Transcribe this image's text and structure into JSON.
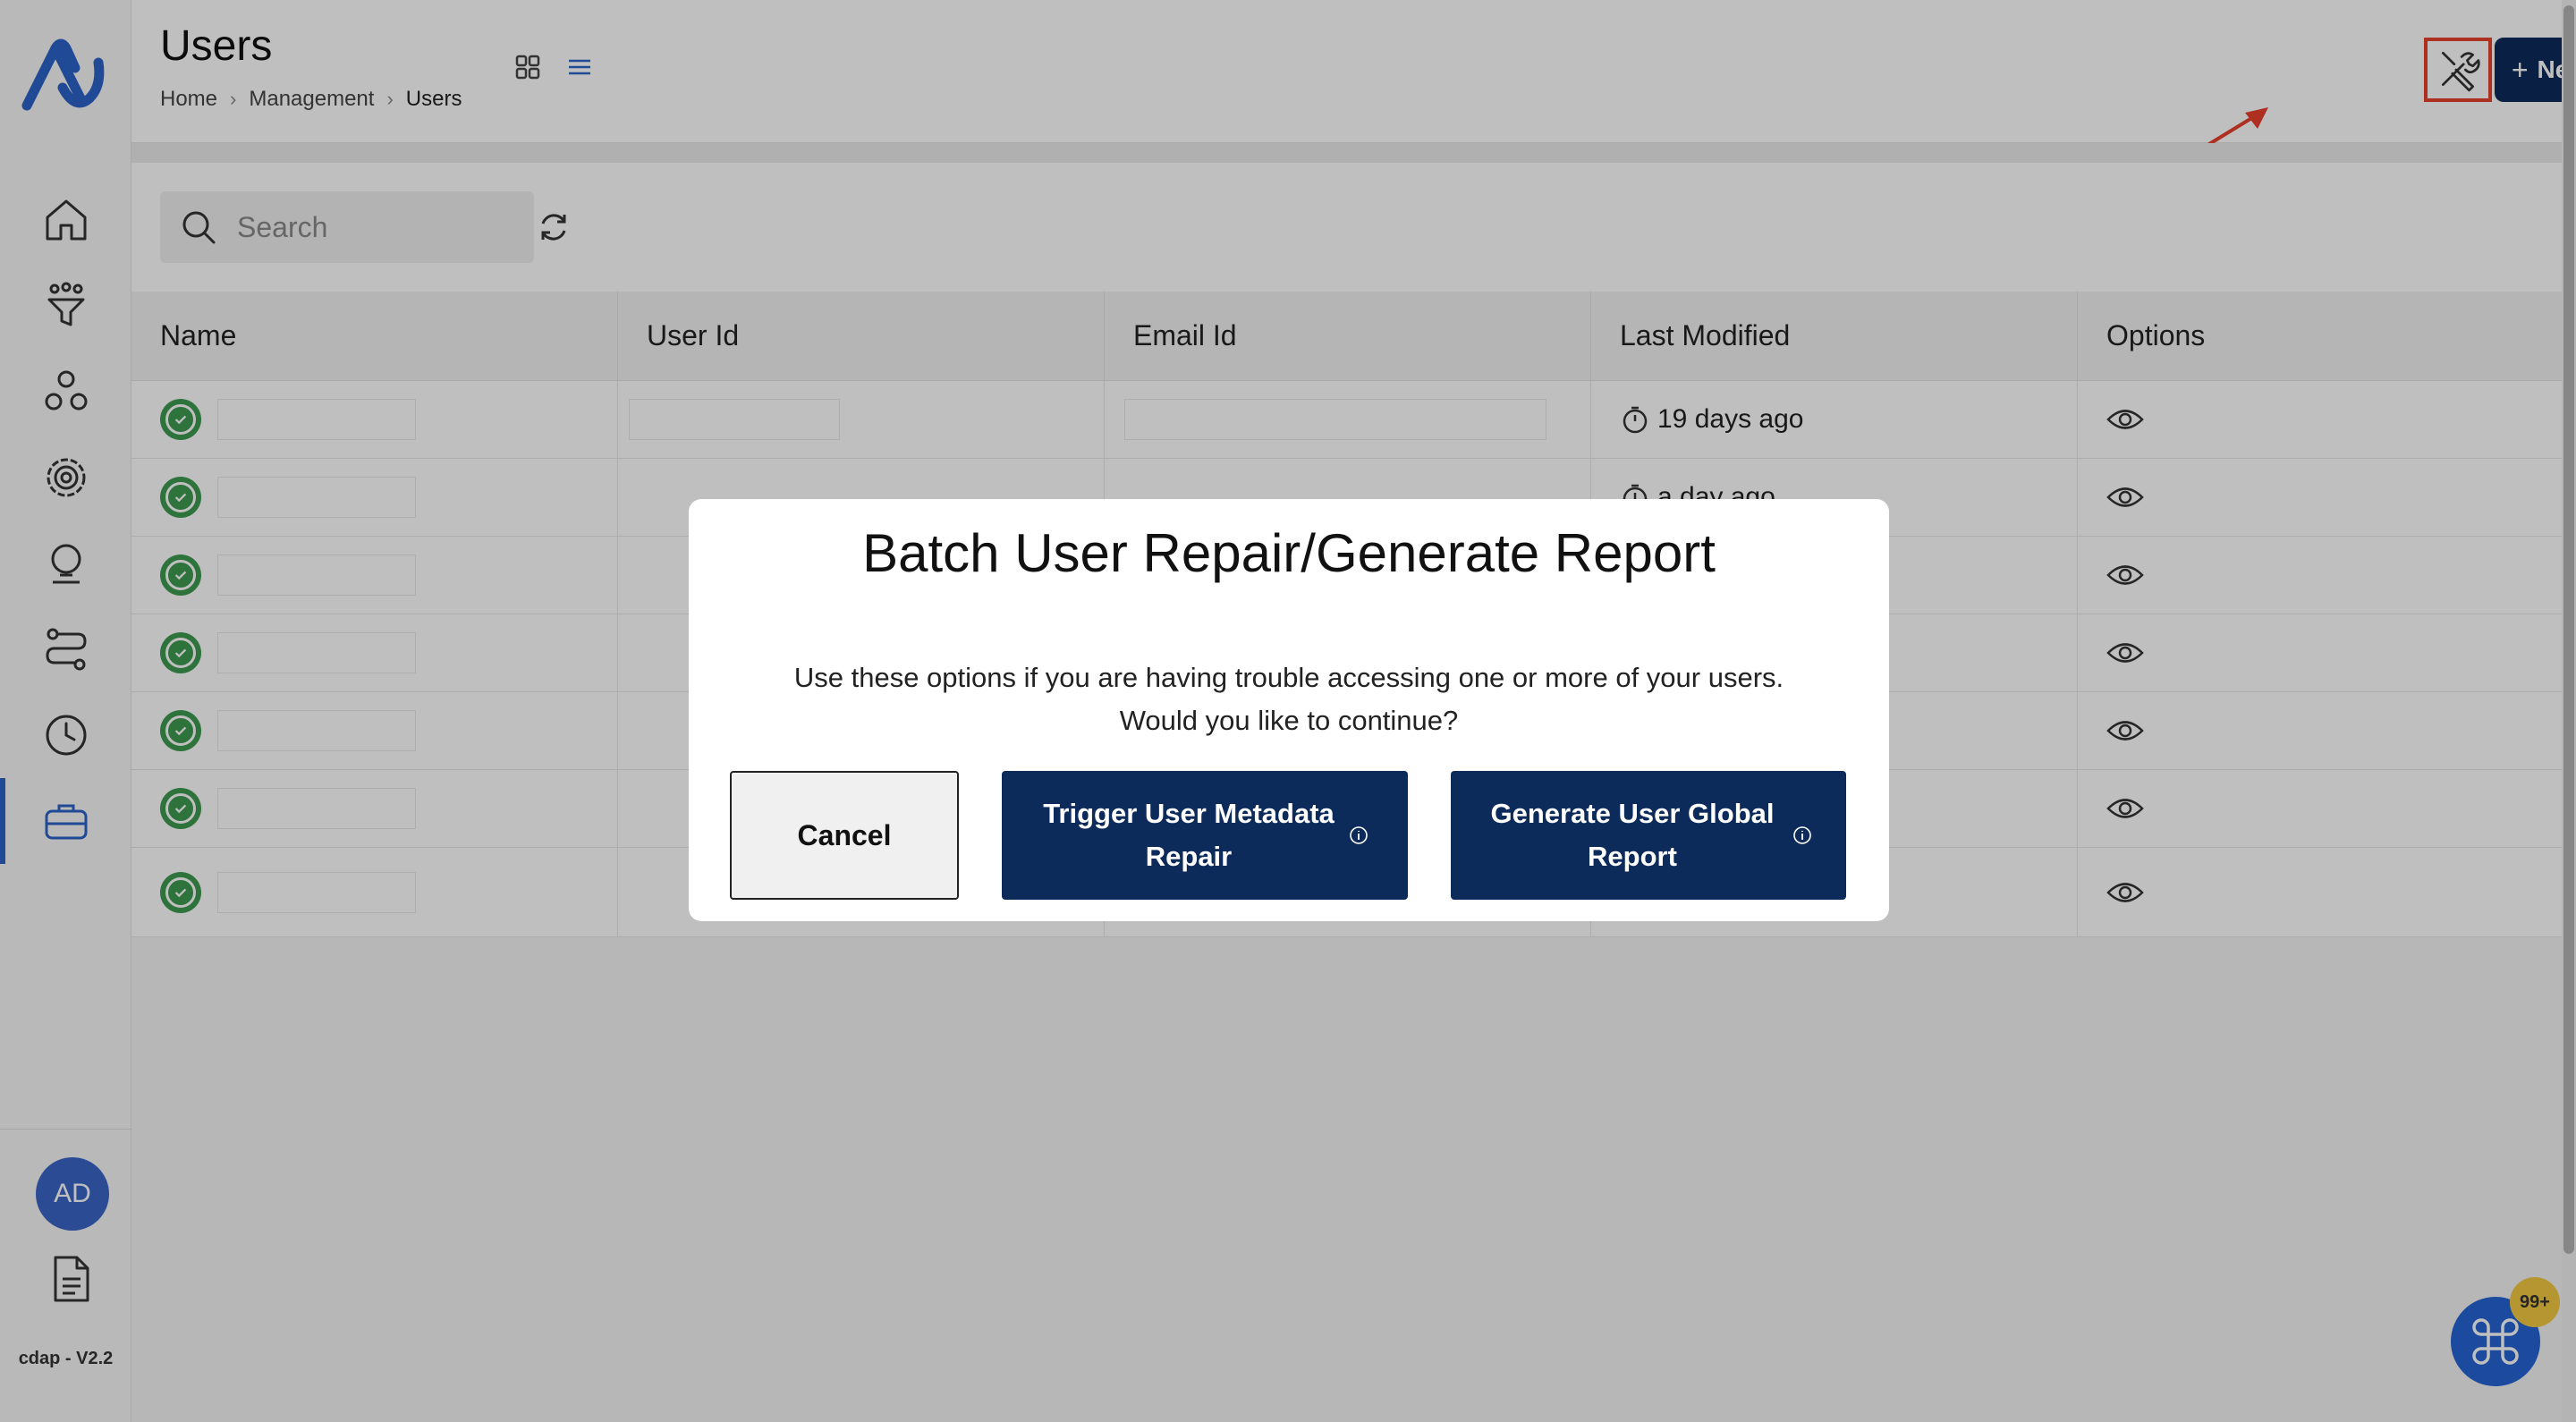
{
  "sidebar": {
    "avatar_initials": "AD",
    "version": "cdap - V2.2",
    "nav_icons": [
      "home-icon",
      "funnel-icon",
      "group-icon",
      "settings-gear-icon",
      "lightbulb-icon",
      "workflow-icon",
      "clock-icon",
      "briefcase-icon"
    ],
    "active_index": 7,
    "accent_color": "#2b63c7"
  },
  "header": {
    "title": "Users",
    "breadcrumb": [
      "Home",
      "Management",
      "Users"
    ],
    "new_user_label": "New User",
    "new_user_icon": "plus-icon",
    "tools_icon": "tools-icon",
    "highlight_color": "#e8402b",
    "brand_color": "#0c2a5a"
  },
  "search": {
    "placeholder": "Search",
    "value": ""
  },
  "table": {
    "columns": [
      "Name",
      "User Id",
      "Email Id",
      "Last Modified",
      "Options"
    ],
    "rows": [
      {
        "last_modified": "19 days ago"
      },
      {
        "last_modified": "a day ago"
      },
      {
        "last_modified": ""
      },
      {
        "last_modified": ""
      },
      {
        "last_modified": ""
      },
      {
        "last_modified": ""
      },
      {
        "last_modified": ""
      }
    ]
  },
  "modal": {
    "title": "Batch User Repair/Generate Report",
    "line1": "Use these options if you are having trouble accessing one or more of your users.",
    "line2": "Would you like to continue?",
    "cancel_label": "Cancel",
    "trigger_label": "Trigger User Metadata Repair",
    "generate_label": "Generate User Global Report"
  },
  "fab": {
    "badge": "99+",
    "icon": "command-icon"
  }
}
